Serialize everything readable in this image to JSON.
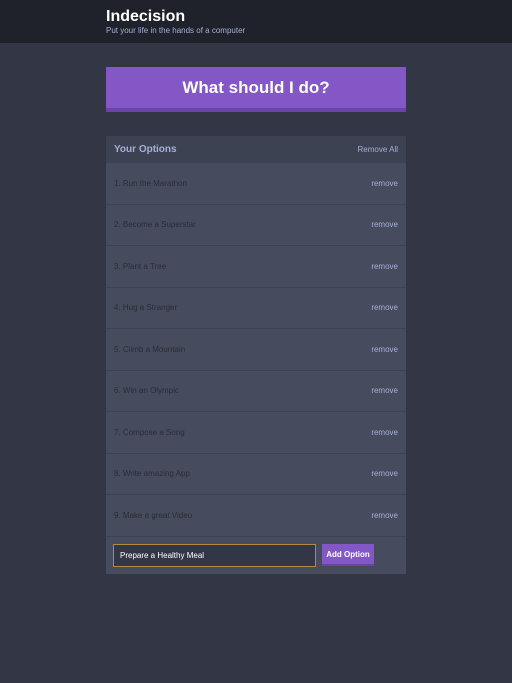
{
  "header": {
    "title": "Indecision",
    "subtitle": "Put your life in the hands of a computer"
  },
  "action": {
    "label": "What should I do?"
  },
  "options": {
    "title": "Your Options",
    "remove_all_label": "Remove All",
    "remove_label": "remove",
    "items": [
      "1. Run the Marathon",
      "2. Become a Superstar",
      "3. Plant a Tree",
      "4. Hug a Stranger",
      "5. Climb a Mountain",
      "6. Win an Olympic",
      "7. Compose a Song",
      "8. Write amazing App",
      "9. Make a great Video"
    ]
  },
  "add_form": {
    "input_value": "Prepare a Healthy Meal",
    "button_label": "Add Option"
  },
  "colors": {
    "accent": "#8357c5",
    "background": "#333745",
    "header_bg": "#20222b",
    "widget_bg": "#464b5e",
    "muted_text": "#a5afd7"
  }
}
